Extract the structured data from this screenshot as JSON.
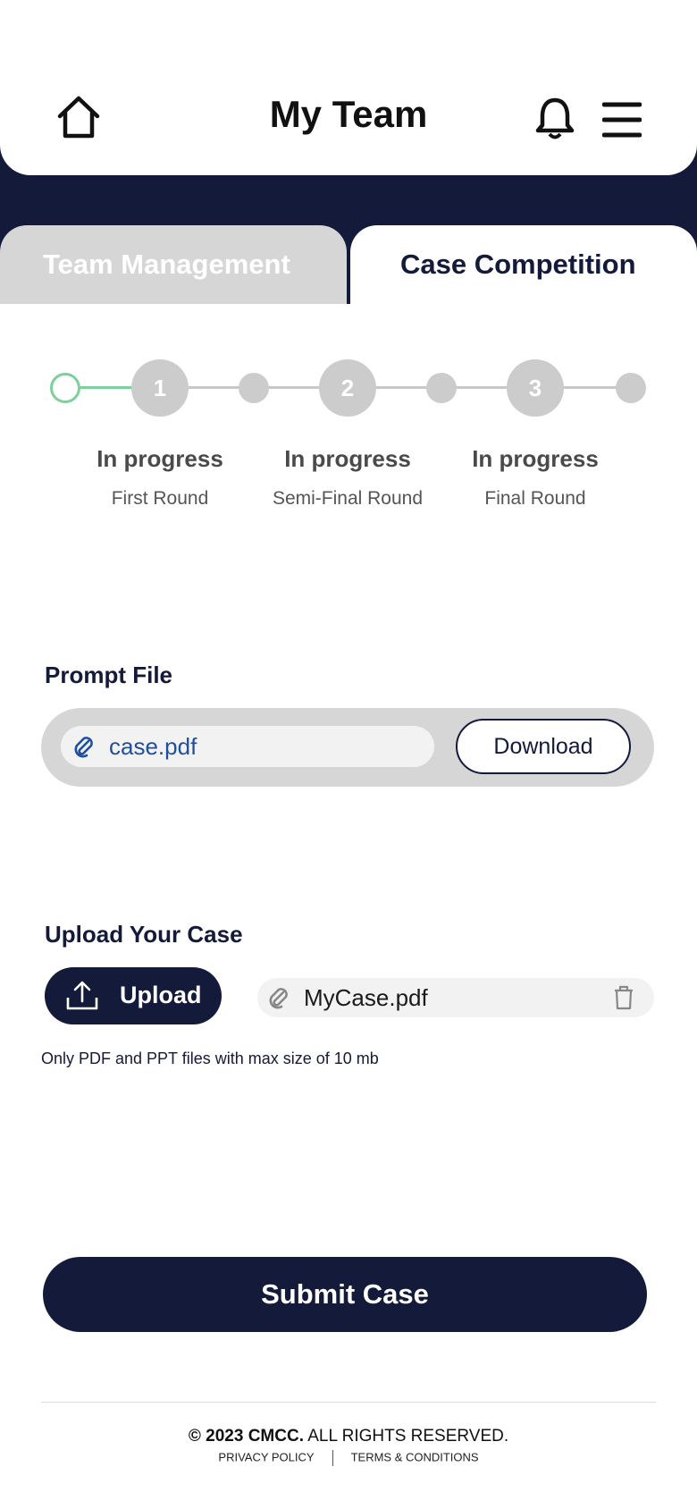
{
  "header": {
    "title": "My Team",
    "icons": {
      "home": "home-icon",
      "bell": "bell-icon",
      "menu": "menu-icon"
    }
  },
  "tabs": [
    {
      "label": "Team Management",
      "active": false
    },
    {
      "label": "Case Competition",
      "active": true
    }
  ],
  "stepper": {
    "steps": [
      {
        "number": "1",
        "status": "In progress",
        "round": "First Round"
      },
      {
        "number": "2",
        "status": "In progress",
        "round": "Semi-Final Round"
      },
      {
        "number": "3",
        "status": "In progress",
        "round": "Final Round"
      }
    ],
    "colors": {
      "start": "#7dcf9c",
      "inactive": "#cccccc"
    }
  },
  "prompt": {
    "label": "Prompt File",
    "filename": "case.pdf",
    "download_label": "Download"
  },
  "upload": {
    "label": "Upload Your Case",
    "button_label": "Upload",
    "filename": "MyCase.pdf",
    "hint": "Only PDF and PPT files with max size of 10 mb"
  },
  "submit_label": "Submit Case",
  "footer": {
    "copyright_bold": "© 2023 CMCC.",
    "copyright_rest": "ALL RIGHTS RESERVED.",
    "privacy": "PRIVACY POLICY",
    "terms": "TERMS & CONDITIONS"
  },
  "colors": {
    "navy": "#131a3a",
    "tab_inactive": "#d6d6d6",
    "link_blue": "#1f4f9e"
  }
}
